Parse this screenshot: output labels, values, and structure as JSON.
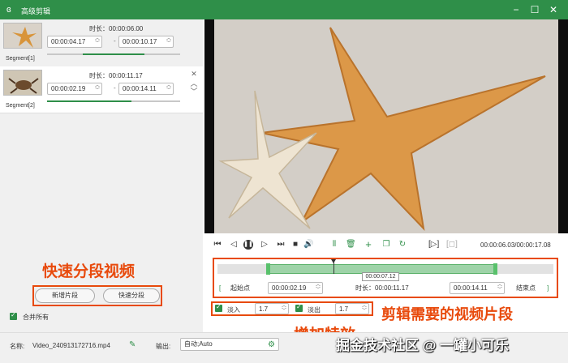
{
  "window": {
    "title": "高级剪辑",
    "minimize": "−",
    "maximize": "☐",
    "close": "✕"
  },
  "segments": [
    {
      "label": "Segment[1]",
      "duration": "时长：00:00:06.00",
      "start": "00:00:04.17",
      "end": "00:00:10.17",
      "progress": 0.42
    },
    {
      "label": "Segment[2]",
      "duration": "时长：00:00:11.17",
      "start": "00:00:02.19",
      "end": "00:00:14.11",
      "progress": 0.64
    }
  ],
  "seg_actions": {
    "close": "✕",
    "up": "︿",
    "down": "﹀"
  },
  "left_buttons": {
    "add_segment": "新增片段",
    "quick_split": "快速分段"
  },
  "merge_all": "合并所有",
  "annotations": {
    "quick_split": "快速分段视频",
    "clip": "剪辑需要的视频片段",
    "effects": "增加特效",
    "watermark": "掘金技术社区 @ 一罐小可乐"
  },
  "player": {
    "time_display": "00:00:06.03/00:00:17.08"
  },
  "timeline": {
    "tooltip": "00:00:07.12",
    "selection_start": 0.15,
    "selection_end": 0.83
  },
  "range": {
    "start_btn": "起始点",
    "start_time": "00:00:02.19",
    "duration_label": "时长：00:00:11.17",
    "end_time": "00:00:14.11",
    "end_btn": "结束点"
  },
  "effects": {
    "fade_in_label": "淡入",
    "fade_in_value": "1.7",
    "fade_out_label": "淡出",
    "fade_out_value": "1.7"
  },
  "bottom": {
    "name_label": "名称:",
    "name_value": "Video_240913172716.mp4",
    "output_label": "输出:",
    "output_value": "自动;Auto"
  },
  "colors": {
    "accent": "#2f8f49",
    "annotation": "#e84a0c"
  }
}
